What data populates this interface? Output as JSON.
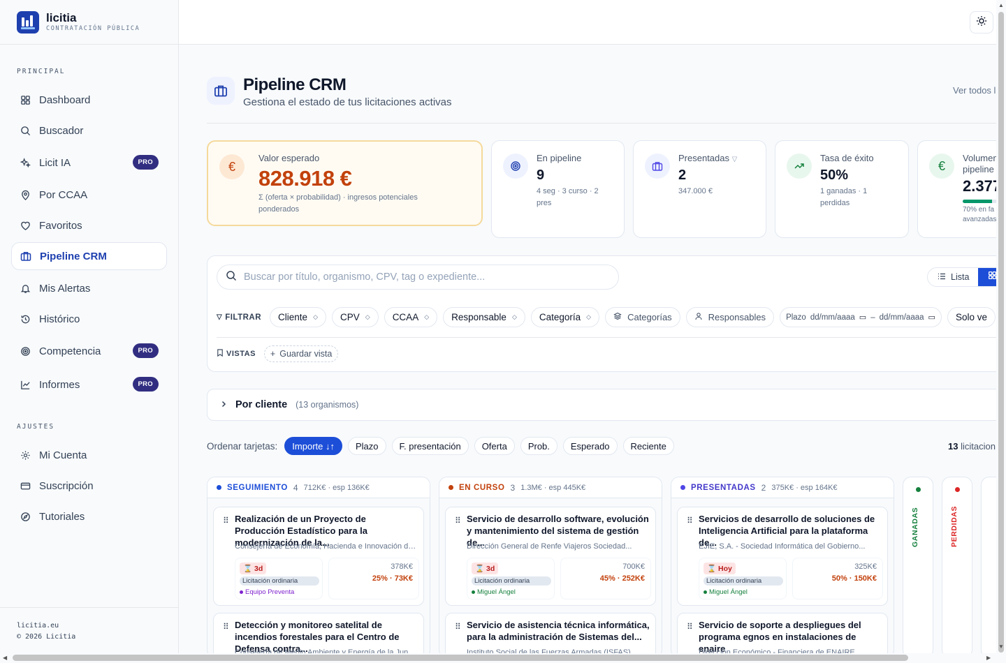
{
  "brand": {
    "name": "licitia",
    "subtitle": "CONTRATACIÓN PÚBLICA"
  },
  "sidebar": {
    "section_principal": "PRINCIPAL",
    "section_ajustes": "AJUSTES",
    "items": [
      {
        "label": "Dashboard",
        "icon": "grid-icon"
      },
      {
        "label": "Buscador",
        "icon": "search-icon"
      },
      {
        "label": "Licit IA",
        "icon": "sparkles-icon",
        "badge": "PRO"
      },
      {
        "label": "Por CCAA",
        "icon": "map-pin-icon"
      },
      {
        "label": "Favoritos",
        "icon": "heart-icon"
      },
      {
        "label": "Pipeline CRM",
        "icon": "briefcase-icon",
        "active": true
      },
      {
        "label": "Mis Alertas",
        "icon": "bell-icon"
      },
      {
        "label": "Histórico",
        "icon": "history-icon"
      },
      {
        "label": "Competencia",
        "icon": "target-icon",
        "badge": "PRO"
      },
      {
        "label": "Informes",
        "icon": "chart-line-icon",
        "badge": "PRO"
      }
    ],
    "settings": [
      {
        "label": "Mi Cuenta",
        "icon": "gear-icon"
      },
      {
        "label": "Suscripción",
        "icon": "credit-card-icon"
      },
      {
        "label": "Tutoriales",
        "icon": "compass-icon"
      }
    ],
    "footer_site": "licitia.eu",
    "footer_copy": "© 2026 Licitia"
  },
  "header": {
    "title": "Pipeline CRM",
    "subtitle": "Gestiona el estado de tus licitaciones activas",
    "see_all": "Ver todos l"
  },
  "kpis": {
    "expected": {
      "label": "Valor esperado",
      "value": "828.918 €",
      "note": "Σ (oferta × probabilidad) · ingresos potenciales ponderados"
    },
    "pipeline": {
      "label": "En pipeline",
      "value": "9",
      "note": "4 seg · 3 curso · 2 pres"
    },
    "presented": {
      "label": "Presentadas",
      "value": "2",
      "note": "347.000 €"
    },
    "success": {
      "label": "Tasa de éxito",
      "value": "50%",
      "note": "1 ganadas · 1 perdidas"
    },
    "volume": {
      "label": "Volumen pipeline",
      "value": "2.377",
      "note": "70% en fa avanzadas",
      "progress": 0.7
    }
  },
  "filters": {
    "search_placeholder": "Buscar por título, organismo, CPV, tag o expediente...",
    "view_list": "Lista",
    "filter_label": "FILTRAR",
    "chips": [
      "Cliente",
      "CPV",
      "CCAA",
      "Responsable",
      "Categoría"
    ],
    "categorias": "Categorías",
    "responsables": "Responsables",
    "plazo": "Plazo",
    "date_from": "dd/mm/aaaa",
    "date_dash": "–",
    "date_to": "dd/mm/aaaa",
    "solo": "Solo ve",
    "views_label": "VISTAS",
    "save_view": "Guardar vista"
  },
  "group": {
    "title": "Por cliente",
    "subtitle": "(13 organismos)"
  },
  "sort": {
    "label": "Ordenar tarjetas:",
    "options": [
      "Importe ↓↑",
      "Plazo",
      "F. presentación",
      "Oferta",
      "Prob.",
      "Esperado",
      "Reciente"
    ],
    "count_number": "13",
    "count_text": " licitacion"
  },
  "columns": [
    {
      "name": "SEGUIMIENTO",
      "count": "4",
      "meta": "712K€ · esp 136K€",
      "color": "#1d4ed8",
      "cards": [
        {
          "title": "Realización de un Proyecto de Producción Estadístico para la modernización de la...",
          "org": "Consejería de Economía, Hacienda e Innovación de...",
          "due": "⌛ 3d",
          "proc": "Licitación ordinaria",
          "owner": "Equipo Preventa",
          "owner_color": "#7e22ce",
          "amount": "378K€",
          "ratio": "25% · 73K€"
        },
        {
          "title": "Detección y monitoreo satelital de incendios forestales para el Centro de Defensa contra...",
          "org": "Consejería de Medio Ambiente y Energía de la Junta..."
        }
      ]
    },
    {
      "name": "EN CURSO",
      "count": "3",
      "meta": "1.3M€ · esp 445K€",
      "color": "#c2410c",
      "cards": [
        {
          "title": "Servicio de desarrollo software, evolución y mantenimiento del sistema de gestión de...",
          "org": "Dirección General de Renfe Viajeros Sociedad...",
          "due": "⌛ 3d",
          "proc": "Licitación ordinaria",
          "owner": "Miguel Ángel",
          "owner_color": "#15803d",
          "amount": "700K€",
          "ratio": "45% · 252K€"
        },
        {
          "title": "Servicio de asistencia técnica informática, para la administración de Sistemas del...",
          "org": "Instituto Social de las Fuerzas Armadas (ISFAS)"
        }
      ]
    },
    {
      "name": "PRESENTADAS",
      "count": "2",
      "meta": "375K€ · esp 164K€",
      "color": "#4f46e5",
      "cards": [
        {
          "title": "Servicios de desarrollo de soluciones de Inteligencia Artificial para la plataforma de...",
          "org": "EJIE, S.A. - Sociedad Informática del Gobierno...",
          "due": "⌛ Hoy",
          "proc": "Licitación ordinaria",
          "owner": "Miguel Ángel",
          "owner_color": "#15803d",
          "amount": "325K€",
          "ratio": "50% · 150K€"
        },
        {
          "title": "Servicio de soporte a despliegues del programa egnos en instalaciones de enaire",
          "org": "Dirección Económico - Financiera de ENAIRE"
        }
      ]
    }
  ],
  "collapsed_columns": [
    {
      "name": "GANADAS",
      "color": "#15803d"
    },
    {
      "name": "PERDIDAS",
      "color": "#dc2626"
    }
  ]
}
